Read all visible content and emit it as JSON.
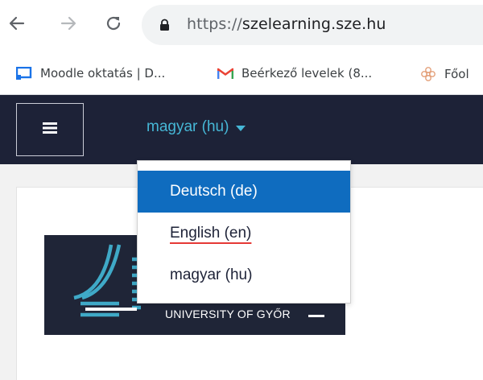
{
  "browser": {
    "url_scheme": "https://",
    "url_host": "szelearning.sze.hu"
  },
  "bookmarks": [
    {
      "label": "Moodle oktatás | D...",
      "icon": "moodle-icon"
    },
    {
      "label": "Beérkező levelek (8...",
      "icon": "gmail-icon"
    },
    {
      "label": "Főol",
      "icon": "flower-icon"
    }
  ],
  "navbar": {
    "language_label": "magyar (hu)"
  },
  "language_menu": {
    "items": [
      {
        "label": "Deutsch (de)",
        "state": "highlighted"
      },
      {
        "label": "English (en)",
        "state": "normal"
      },
      {
        "label": "magyar (hu)",
        "state": "normal"
      }
    ]
  },
  "logo": {
    "subtitle": "UNIVERSITY OF GYŐR"
  },
  "colors": {
    "navbar_bg": "#1d2237",
    "language_accent": "#46b7d6",
    "menu_highlight": "#0f6cbf",
    "logo_accent": "#3fa9c7"
  }
}
